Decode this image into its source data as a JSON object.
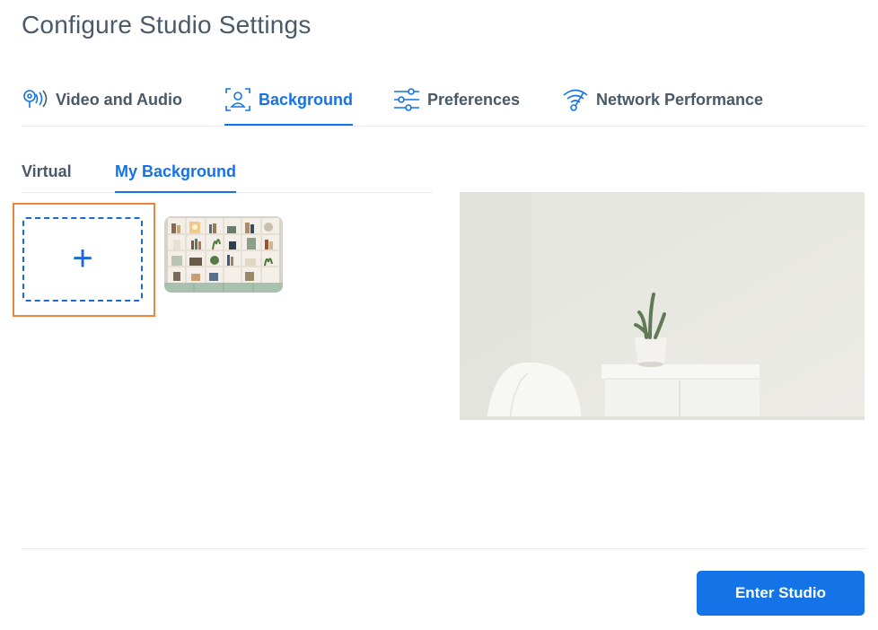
{
  "page": {
    "title": "Configure Studio Settings"
  },
  "main_tabs": [
    {
      "label": "Video and Audio",
      "icon": "video-audio-icon",
      "active": false
    },
    {
      "label": "Background",
      "icon": "background-person-icon",
      "active": true
    },
    {
      "label": "Preferences",
      "icon": "sliders-icon",
      "active": false
    },
    {
      "label": "Network Performance",
      "icon": "wifi-speed-icon",
      "active": false
    }
  ],
  "sub_tabs": [
    {
      "label": "Virtual",
      "active": false
    },
    {
      "label": "My Background",
      "active": true
    }
  ],
  "uploads": {
    "add_symbol": "+",
    "items": [
      {
        "name": "bookshelf-background",
        "selected": false
      }
    ]
  },
  "preview": {
    "name": "room-preview"
  },
  "footer": {
    "enter_label": "Enter Studio"
  },
  "colors": {
    "accent": "#1473e6",
    "highlight": "#f0823a",
    "text": "#4a5868"
  }
}
